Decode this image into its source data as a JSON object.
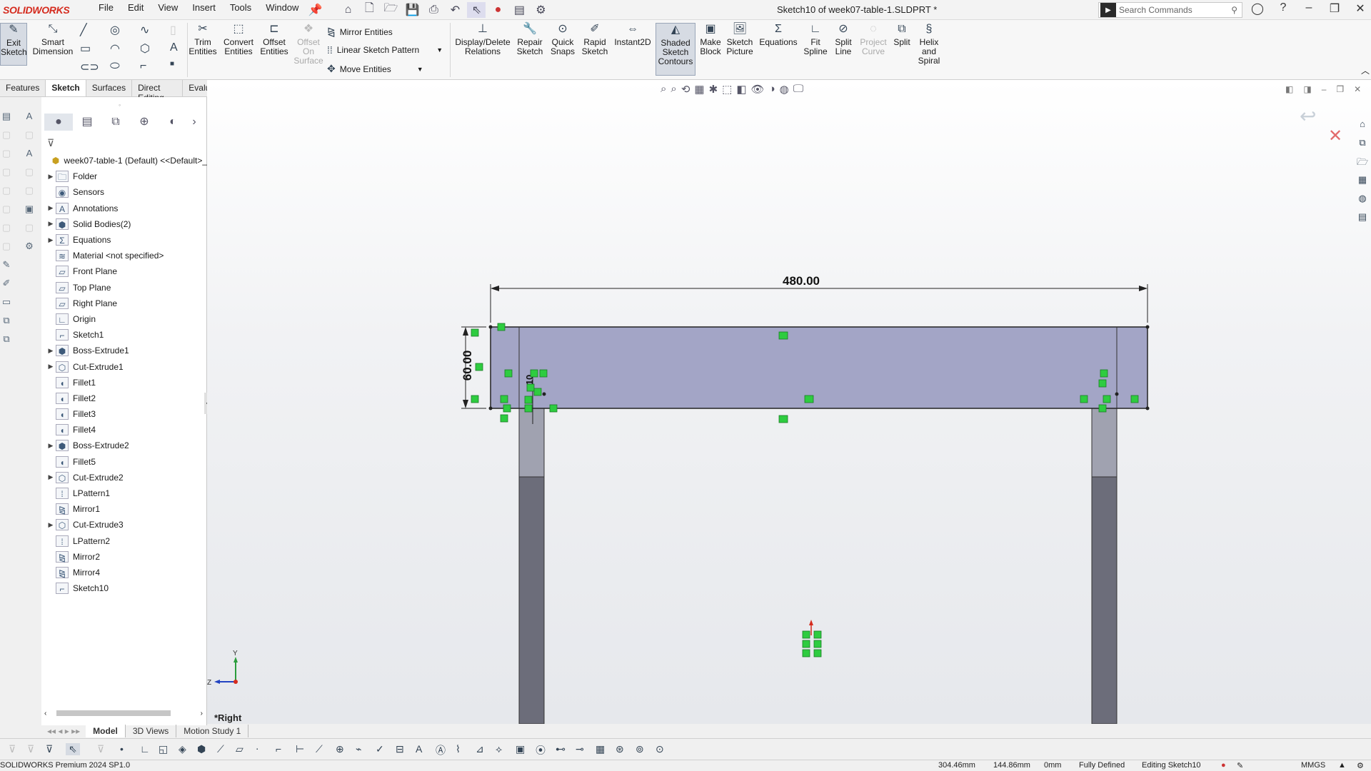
{
  "app": {
    "logo": "SOLIDWORKS",
    "doc_title": "Sketch10 of week07-table-1.SLDPRT *",
    "menus": [
      "File",
      "Edit",
      "View",
      "Insert",
      "Tools",
      "Window"
    ],
    "search_placeholder": "Search Commands"
  },
  "toolbar": {
    "exit_sketch": "Exit Sketch",
    "smart_dimension": "Smart Dimension",
    "trim_entities": "Trim Entities",
    "convert_entities": "Convert Entities",
    "offset_entities": "Offset Entities",
    "offset_on_surface": "Offset On Surface",
    "mirror_entities": "Mirror Entities",
    "linear_sketch_pattern": "Linear Sketch Pattern",
    "move_entities": "Move Entities",
    "display_delete_relations": "Display/Delete Relations",
    "repair_sketch": "Repair Sketch",
    "quick_snaps": "Quick Snaps",
    "rapid_sketch": "Rapid Sketch",
    "instant2d": "Instant2D",
    "shaded_sketch_contours": "Shaded Sketch Contours",
    "make_block": "Make Block",
    "sketch_picture": "Sketch Picture",
    "equations": "Equations",
    "fit_spline": "Fit Spline",
    "split_line": "Split Line",
    "project_curve": "Project Curve",
    "split": "Split",
    "helix_and_spiral": "Helix and Spiral"
  },
  "cmd_tabs": [
    "Features",
    "Sketch",
    "Surfaces",
    "Direct Editing",
    "Evaluate"
  ],
  "feature_tree": {
    "root": "week07-table-1 (Default) <<Default>_",
    "items": [
      {
        "label": "Folder",
        "exp": true,
        "icon": "folder-icon"
      },
      {
        "label": "Sensors",
        "exp": false,
        "icon": "sensor-icon"
      },
      {
        "label": "Annotations",
        "exp": true,
        "icon": "annotation-icon"
      },
      {
        "label": "Solid Bodies(2)",
        "exp": true,
        "icon": "solid-bodies-icon"
      },
      {
        "label": "Equations",
        "exp": true,
        "icon": "equations-icon"
      },
      {
        "label": "Material <not specified>",
        "exp": false,
        "icon": "material-icon"
      },
      {
        "label": "Front Plane",
        "exp": false,
        "icon": "plane-icon"
      },
      {
        "label": "Top Plane",
        "exp": false,
        "icon": "plane-icon"
      },
      {
        "label": "Right Plane",
        "exp": false,
        "icon": "plane-icon"
      },
      {
        "label": "Origin",
        "exp": false,
        "icon": "origin-icon"
      },
      {
        "label": "Sketch1",
        "exp": false,
        "icon": "sketch-icon"
      },
      {
        "label": "Boss-Extrude1",
        "exp": true,
        "icon": "extrude-icon"
      },
      {
        "label": "Cut-Extrude1",
        "exp": true,
        "icon": "cut-extrude-icon"
      },
      {
        "label": "Fillet1",
        "exp": false,
        "icon": "fillet-icon"
      },
      {
        "label": "Fillet2",
        "exp": false,
        "icon": "fillet-icon"
      },
      {
        "label": "Fillet3",
        "exp": false,
        "icon": "fillet-icon"
      },
      {
        "label": "Fillet4",
        "exp": false,
        "icon": "fillet-icon"
      },
      {
        "label": "Boss-Extrude2",
        "exp": true,
        "icon": "extrude-icon"
      },
      {
        "label": "Fillet5",
        "exp": false,
        "icon": "fillet-icon"
      },
      {
        "label": "Cut-Extrude2",
        "exp": true,
        "icon": "cut-extrude-icon"
      },
      {
        "label": "LPattern1",
        "exp": false,
        "icon": "pattern-icon"
      },
      {
        "label": "Mirror1",
        "exp": false,
        "icon": "mirror-icon"
      },
      {
        "label": "Cut-Extrude3",
        "exp": true,
        "icon": "cut-extrude-icon"
      },
      {
        "label": "LPattern2",
        "exp": false,
        "icon": "pattern-icon"
      },
      {
        "label": "Mirror2",
        "exp": false,
        "icon": "mirror-icon"
      },
      {
        "label": "Mirror4",
        "exp": false,
        "icon": "mirror-icon"
      },
      {
        "label": "Sketch10",
        "exp": false,
        "icon": "sketch-icon"
      }
    ]
  },
  "bottom_tabs": [
    "Model",
    "3D Views",
    "Motion Study 1"
  ],
  "viewport": {
    "view_name": "*Right",
    "dim_width": "480.00",
    "dim_height": "60.00",
    "dim_small": "10",
    "triad_y": "Y",
    "triad_z": "Z"
  },
  "status": {
    "product": "SOLIDWORKS Premium 2024 SP1.0",
    "x": "304.46mm",
    "y": "144.86mm",
    "z": "0mm",
    "defined": "Fully Defined",
    "editing": "Editing Sketch10",
    "units": "MMGS"
  },
  "colors": {
    "accent_red": "#d52b1e",
    "sketch_fill": "#a3a5c6",
    "leg_fill": "#6c6d7a",
    "relation_green": "#2ecc40"
  }
}
